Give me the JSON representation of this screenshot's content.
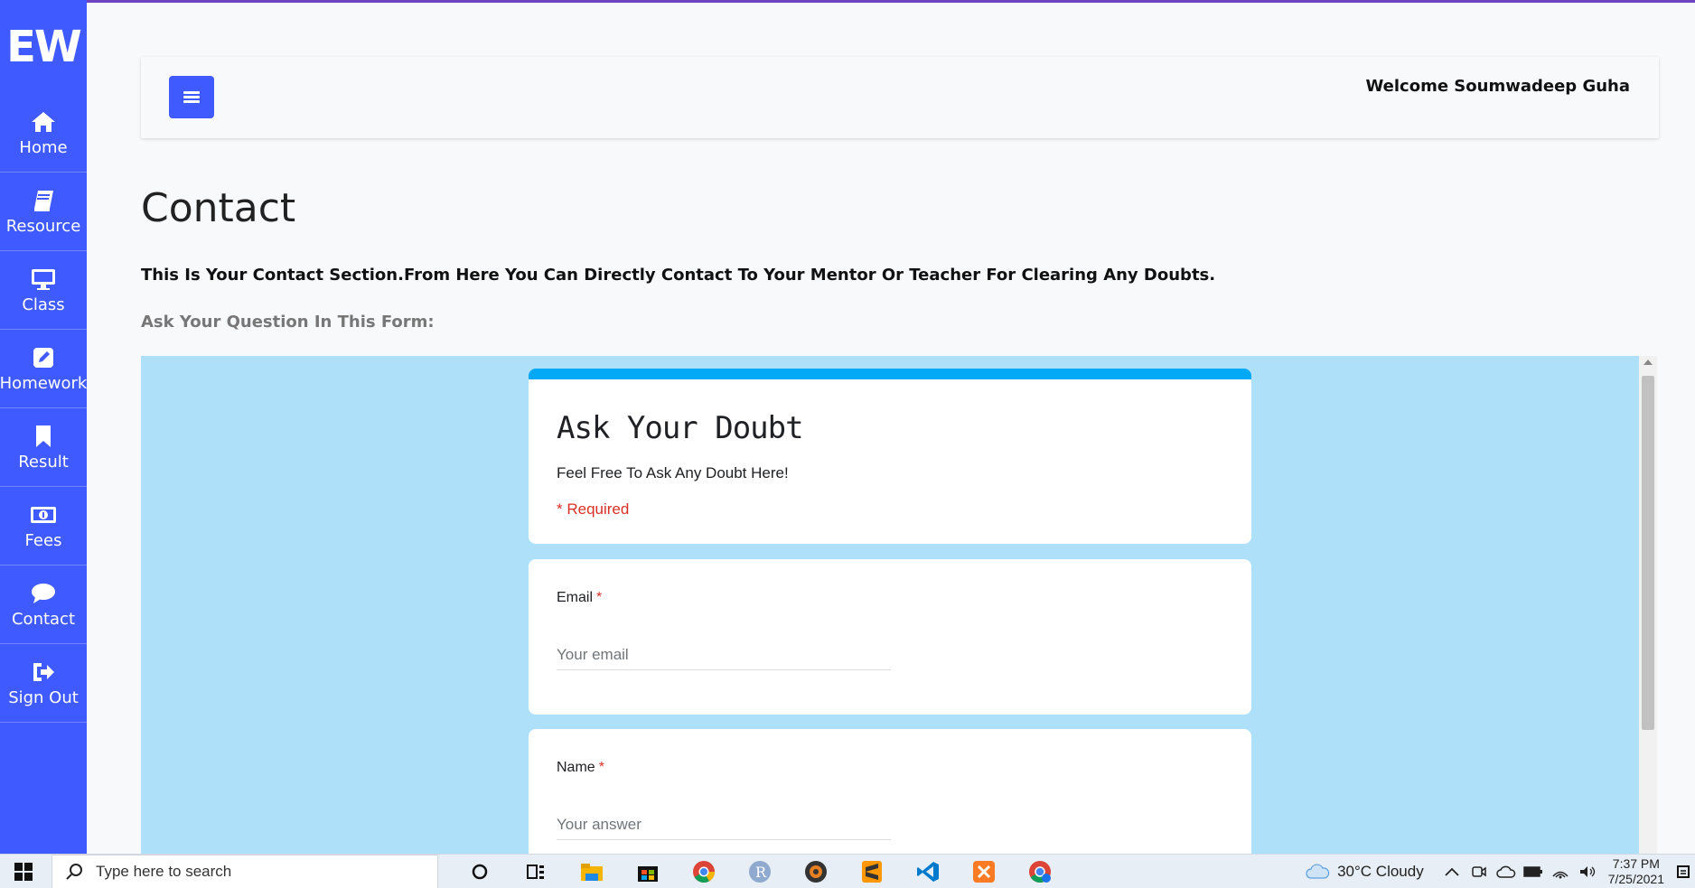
{
  "app": {
    "logo": "EW",
    "welcome_text": "Welcome Soumwadeep Guha"
  },
  "sidebar": {
    "items": [
      {
        "label": "Home",
        "icon": "home-icon"
      },
      {
        "label": "Resource",
        "icon": "book-icon"
      },
      {
        "label": "Class",
        "icon": "desktop-icon"
      },
      {
        "label": "Homework",
        "icon": "pencil-icon"
      },
      {
        "label": "Result",
        "icon": "bookmark-icon"
      },
      {
        "label": "Fees",
        "icon": "money-icon"
      },
      {
        "label": "Contact",
        "icon": "chat-icon"
      },
      {
        "label": "Sign Out",
        "icon": "sign-out-icon"
      }
    ]
  },
  "main": {
    "title": "Contact",
    "intro": "This Is Your Contact Section.From Here You Can Directly Contact To Your Mentor Or Teacher For Clearing Any Doubts.",
    "form_label": "Ask Your Question In This Form:"
  },
  "form": {
    "title": "Ask Your Doubt",
    "description": "Feel Free To Ask Any Doubt Here!",
    "required_note": "* Required",
    "questions": [
      {
        "label": "Email",
        "required_mark": "*",
        "placeholder": "Your email"
      },
      {
        "label": "Name",
        "required_mark": "*",
        "placeholder": "Your answer"
      }
    ]
  },
  "taskbar": {
    "search_placeholder": "Type here to search",
    "weather": "30°C  Cloudy",
    "time": "7:37 PM",
    "date": "7/25/2021",
    "apps": [
      "cortana-icon",
      "task-view-icon",
      "file-explorer-icon",
      "store-icon",
      "chrome-icon",
      "r-icon",
      "media-icon",
      "sublime-icon",
      "vscode-icon",
      "xampp-icon",
      "chrome-profile-icon"
    ]
  },
  "colors": {
    "sidebar": "#3f5bff",
    "form_bg": "#aee1f9",
    "form_accent": "#03a9f4",
    "required": "#d93025"
  }
}
